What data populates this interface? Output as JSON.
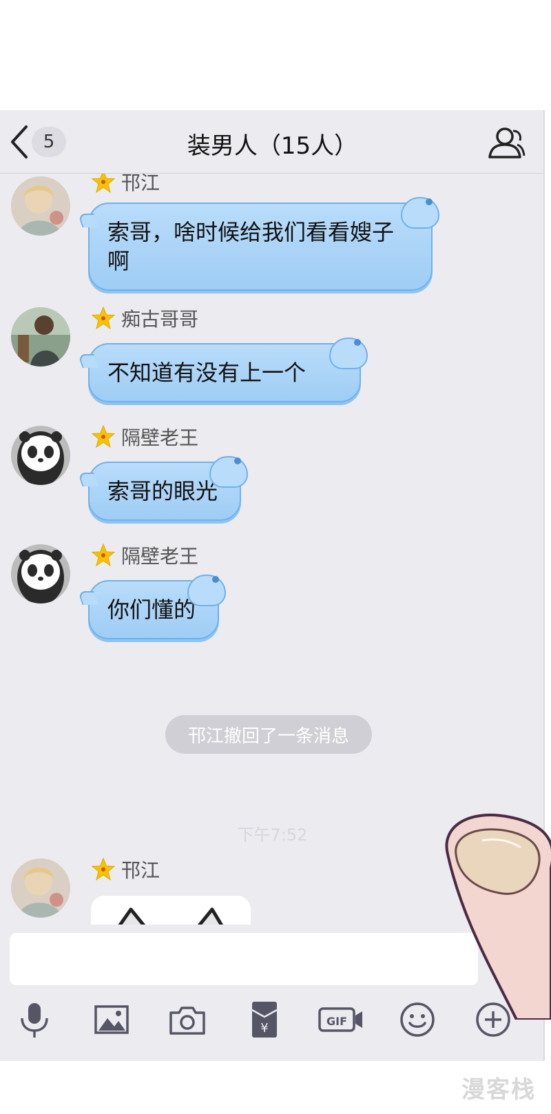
{
  "nav": {
    "unread_count": "5",
    "title": "装男人（15人）"
  },
  "messages": [
    {
      "sender": "邗江",
      "text": "索哥，啥时候给我们看看嫂子啊"
    },
    {
      "sender": "痴古哥哥",
      "text": "不知道有没有上一个"
    },
    {
      "sender": "隔壁老王",
      "text": "索哥的眼光"
    },
    {
      "sender": "隔壁老王",
      "text": "你们懂的"
    }
  ],
  "system_notice": "邗江撤回了一条消息",
  "timestamp": "下午7:52",
  "last_message": {
    "sender": "邗江"
  },
  "input": {
    "value": "",
    "placeholder": ""
  },
  "toolbar": [
    "mic-icon",
    "image-icon",
    "camera-icon",
    "red-packet-icon",
    "gif-icon",
    "emoji-icon",
    "plus-icon"
  ],
  "watermark": "漫客栈",
  "colors": {
    "bubble": "#b9dcfa",
    "bubble_border": "#6fb1ea",
    "background": "#ebebf0",
    "star": "#f5c400",
    "icons": "#555566"
  }
}
